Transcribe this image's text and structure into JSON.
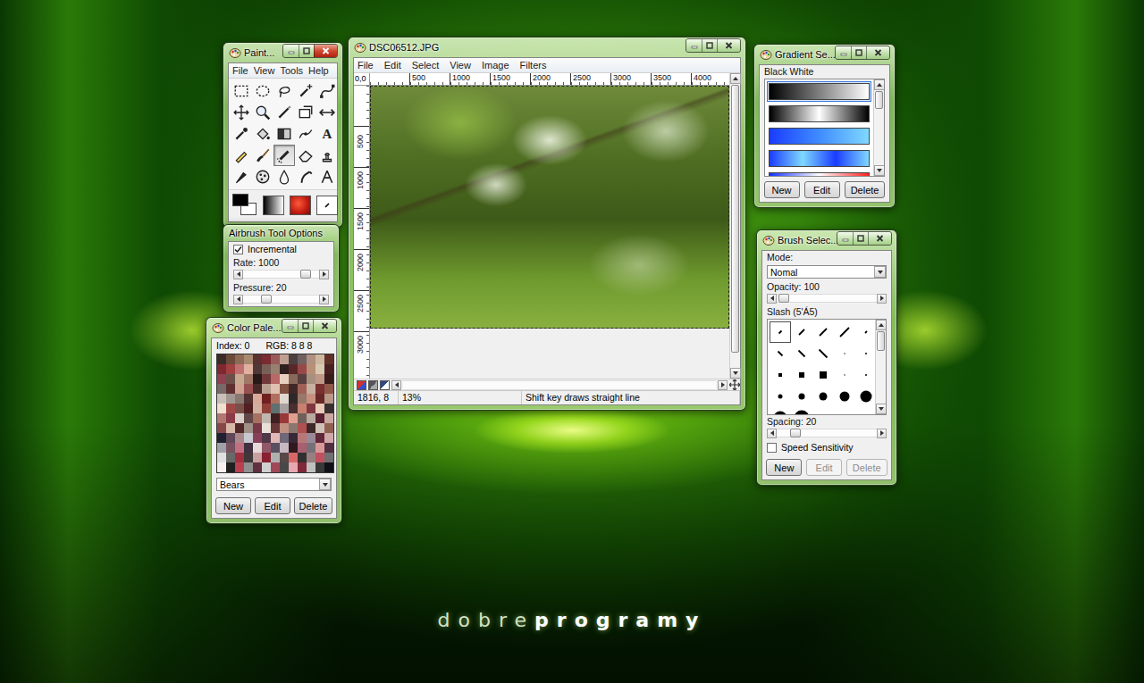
{
  "desktop": {
    "logo": {
      "light": "dobre",
      "bold": "programy"
    }
  },
  "toolbox": {
    "title": "Paint...",
    "active": true,
    "menu": [
      "File",
      "View",
      "Tools",
      "Help"
    ],
    "tools": [
      {
        "kind": "rect-select",
        "selected": false
      },
      {
        "kind": "ellipse-select",
        "selected": false
      },
      {
        "kind": "lasso",
        "selected": false
      },
      {
        "kind": "magic-wand",
        "selected": false
      },
      {
        "kind": "bezier",
        "selected": false
      },
      {
        "kind": "move",
        "selected": false
      },
      {
        "kind": "zoom",
        "selected": false
      },
      {
        "kind": "crop",
        "selected": false
      },
      {
        "kind": "transform",
        "selected": false
      },
      {
        "kind": "flip",
        "selected": false
      },
      {
        "kind": "eyedropper",
        "selected": false
      },
      {
        "kind": "bucket",
        "selected": false
      },
      {
        "kind": "blend",
        "selected": false
      },
      {
        "kind": "path",
        "selected": false
      },
      {
        "kind": "text",
        "glyph": "A",
        "selected": false
      },
      {
        "kind": "pencil",
        "selected": false
      },
      {
        "kind": "brush",
        "selected": false
      },
      {
        "kind": "airbrush",
        "selected": true
      },
      {
        "kind": "eraser",
        "selected": false
      },
      {
        "kind": "clone",
        "selected": false
      },
      {
        "kind": "ink",
        "selected": false
      },
      {
        "kind": "dodge",
        "selected": false
      },
      {
        "kind": "blur",
        "selected": false
      },
      {
        "kind": "smudge",
        "selected": false
      },
      {
        "kind": "measure",
        "selected": false
      }
    ],
    "foreground": "#000000",
    "background": "#ffffff"
  },
  "tool_options": {
    "title": "Airbrush Tool Options",
    "incremental": {
      "label": "Incremental",
      "checked": true
    },
    "sliders": [
      {
        "label": "Rate: 1000",
        "level": 0.87
      },
      {
        "label": "Pressure: 20",
        "level": 0.27
      }
    ]
  },
  "palette": {
    "title": "Color Pale...",
    "active": false,
    "index": "Index: 0",
    "rgb": "RGB: 8 8 8",
    "colors": [
      "#3a2a28",
      "#6b4a3a",
      "#8c6a55",
      "#a88a70",
      "#5a3030",
      "#7a2a30",
      "#9a5a5a",
      "#c0a090",
      "#4a4040",
      "#706060",
      "#b09080",
      "#d0b8a0",
      "#603028",
      "#802830",
      "#a04040",
      "#c07070",
      "#e0b0a0",
      "#503838",
      "#786058",
      "#988070",
      "#302020",
      "#582828",
      "#984848",
      "#b89078",
      "#d8c8b0",
      "#482020",
      "#904050",
      "#6a5048",
      "#c8a890",
      "#a07868",
      "#281818",
      "#703838",
      "#b86868",
      "#e8d0c0",
      "#886858",
      "#584040",
      "#a89080",
      "#c09888",
      "#381c1c",
      "#786868",
      "#603030",
      "#d0a090",
      "#985050",
      "#482828",
      "#b8a090",
      "#e0c0b0",
      "#805040",
      "#402828",
      "#a06058",
      "#c8b0a0",
      "#783030",
      "#905848",
      "#c8c0b8",
      "#a09890",
      "#887870",
      "#503030",
      "#d8a898",
      "#702020",
      "#b07060",
      "#e0d8d0",
      "#302828",
      "#987868",
      "#c89080",
      "#682828",
      "#b89888",
      "#f0e0d0",
      "#a04848",
      "#785048",
      "#502020",
      "#d0b0a0",
      "#904038",
      "#607070",
      "#a8a0a0",
      "#483030",
      "#c88070",
      "#803840",
      "#e8c8b8",
      "#383030",
      "#b07870",
      "#8a3a48",
      "#d8d0c8",
      "#604848",
      "#a87060",
      "#c0b8b0",
      "#402020",
      "#983838",
      "#e0a090",
      "#706058",
      "#b8a8a0",
      "#582030",
      "#c8a8a0",
      "#884848",
      "#d8b8a8",
      "#502828",
      "#a09088",
      "#783848",
      "#e8e0d8",
      "#683838",
      "#c09080",
      "#8a7870",
      "#b05050",
      "#402828",
      "#d0c0b8",
      "#906050",
      "#202030",
      "#604858",
      "#a88888",
      "#c8c8d0",
      "#884058",
      "#503848",
      "#e0b8b8",
      "#706878",
      "#382838",
      "#b87878",
      "#988898",
      "#602838",
      "#d0a8a8",
      "#a0a0a8",
      "#785060",
      "#c07080",
      "#403040",
      "#e8d8d8",
      "#905868",
      "#585060",
      "#c8b8c0",
      "#301820",
      "#a86070",
      "#787078",
      "#d89898",
      "#503040",
      "#e0e0e0",
      "#686868",
      "#a03040",
      "#403838",
      "#c8a0a0",
      "#882030",
      "#b0b0b0",
      "#584848",
      "#d86868",
      "#303030",
      "#988080",
      "#c05060",
      "#707070",
      "#f8f0f0",
      "#202020",
      "#b84050",
      "#909090",
      "#603040",
      "#d0d0d0",
      "#a04858",
      "#484848",
      "#e8a8b0",
      "#802838",
      "#c0c0c0",
      "#383838",
      "#101018"
    ],
    "name": "Bears",
    "buttons": [
      {
        "label": "New",
        "disabled": false
      },
      {
        "label": "Edit",
        "disabled": false
      },
      {
        "label": "Delete",
        "disabled": false
      }
    ]
  },
  "image": {
    "title": "DSC06512.JPG",
    "active": false,
    "menu": [
      "File",
      "Edit",
      "Select",
      "View",
      "Image",
      "Filters"
    ],
    "corner": "0,0",
    "h_ruler": [
      "500",
      "1000",
      "1500",
      "2000",
      "2500",
      "3000",
      "3500",
      "4000"
    ],
    "v_ruler": [
      "500",
      "1000",
      "1500",
      "2000",
      "2500",
      "3000"
    ],
    "status": {
      "position": "1816, 8",
      "zoom": "13%",
      "hint": "Shift key draws straight line"
    }
  },
  "gradients": {
    "title": "Gradient Se...",
    "active": false,
    "current": "Black White",
    "items": [
      {
        "stops": [
          "#000000",
          "#ffffff"
        ],
        "selected": true
      },
      {
        "stops": [
          "#000000",
          "#ffffff",
          "#000000"
        ],
        "selected": false
      },
      {
        "stops": [
          "#1a3cff",
          "#3f8cff",
          "#7fd8ff"
        ],
        "selected": false
      },
      {
        "stops": [
          "#1a3cff",
          "#7fd8ff",
          "#1a3cff",
          "#7fd8ff"
        ],
        "selected": false
      },
      {
        "stops": [
          "#1030ff",
          "#ffffff",
          "#ff2020"
        ],
        "selected": false
      }
    ],
    "buttons": [
      {
        "label": "New",
        "disabled": false
      },
      {
        "label": "Edit",
        "disabled": false
      },
      {
        "label": "Delete",
        "disabled": false
      }
    ]
  },
  "brushes": {
    "title": "Brush Selec...",
    "active": false,
    "mode_label": "Mode:",
    "mode": "Nomal",
    "opacity": {
      "label": "Opacity: 100",
      "level": 0.02
    },
    "current": "Slash (5'Á5)",
    "items": [
      {
        "kind": "slash",
        "size": 3,
        "selected": true
      },
      {
        "kind": "slash",
        "size": 6,
        "selected": false
      },
      {
        "kind": "slash",
        "size": 8,
        "selected": false
      },
      {
        "kind": "slash",
        "size": 10,
        "selected": false
      },
      {
        "kind": "slash",
        "size": 2,
        "selected": false
      },
      {
        "kind": "backslash",
        "size": 5,
        "selected": false
      },
      {
        "kind": "backslash",
        "size": 7,
        "selected": false
      },
      {
        "kind": "backslash",
        "size": 9,
        "selected": false
      },
      {
        "kind": "circle",
        "size": 1,
        "selected": false
      },
      {
        "kind": "circle",
        "size": 2,
        "selected": false
      },
      {
        "kind": "square",
        "size": 4,
        "selected": false
      },
      {
        "kind": "square",
        "size": 6,
        "selected": false
      },
      {
        "kind": "square",
        "size": 8,
        "selected": false
      },
      {
        "kind": "circle",
        "size": 1,
        "selected": false
      },
      {
        "kind": "circle",
        "size": 2,
        "selected": false
      },
      {
        "kind": "circle",
        "size": 5,
        "selected": false
      },
      {
        "kind": "circle",
        "size": 7,
        "selected": false
      },
      {
        "kind": "circle",
        "size": 9,
        "selected": false
      },
      {
        "kind": "circle",
        "size": 11,
        "selected": false
      },
      {
        "kind": "circle",
        "size": 13,
        "selected": false
      },
      {
        "kind": "circle",
        "size": 15,
        "selected": false
      },
      {
        "kind": "circle",
        "size": 17,
        "selected": false
      }
    ],
    "spacing": {
      "label": "Spacing: 20",
      "level": 0.15
    },
    "speed": {
      "label": "Speed Sensitivity",
      "checked": false
    },
    "buttons": [
      {
        "label": "New",
        "disabled": false
      },
      {
        "label": "Edit",
        "disabled": true
      },
      {
        "label": "Delete",
        "disabled": true
      }
    ]
  }
}
